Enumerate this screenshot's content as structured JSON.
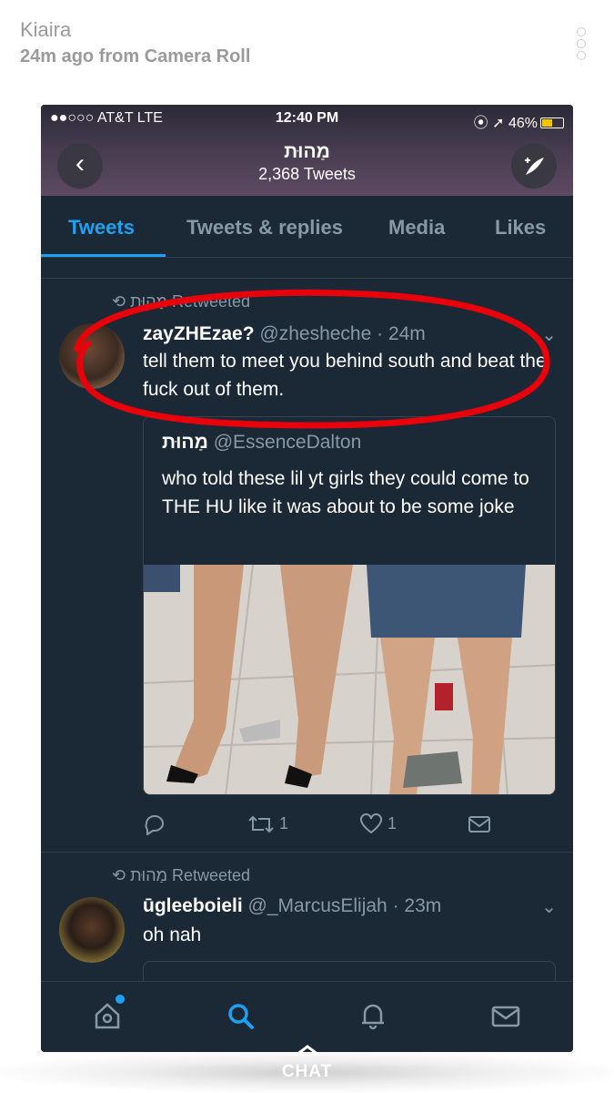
{
  "snap": {
    "sender": "Kiaira",
    "meta": "24m ago from Camera Roll"
  },
  "status_bar": {
    "carrier": "●●○○○ AT&T  LTE",
    "time": "12:40 PM",
    "battery": "46%",
    "battery_color": "#f5c400"
  },
  "profile": {
    "name": "מַהוּת",
    "tweet_count": "2,368 Tweets"
  },
  "tabs": [
    {
      "label": "Tweets",
      "active": true
    },
    {
      "label": "Tweets & replies",
      "active": false
    },
    {
      "label": "Media",
      "active": false
    },
    {
      "label": "Likes",
      "active": false
    }
  ],
  "tweets": [
    {
      "retweeted_by": "מַהוּת Retweeted",
      "name": "zayZHEzae?",
      "handle": "@zhesheche · 24m",
      "text": "tell them to meet you behind south and beat the fuck out of them.",
      "quote": {
        "name": "מַהוּת",
        "handle": "@EssenceDalton",
        "text": "who told these lil yt girls they could come to THE HU like it was about to be some joke"
      },
      "retweets": "1",
      "likes": "1"
    },
    {
      "retweeted_by": "מַהוּת Retweeted",
      "name": "ūgleeboieli",
      "handle": "@_MarcusElijah · 23m",
      "text": "oh nah"
    }
  ],
  "bottom_nav": [
    "home-icon",
    "search-icon",
    "notifications-icon",
    "messages-icon"
  ],
  "chat_label": "CHAT",
  "colors": {
    "accent": "#1da1f2",
    "background": "#1b2836",
    "annotation": "#e8000b"
  }
}
